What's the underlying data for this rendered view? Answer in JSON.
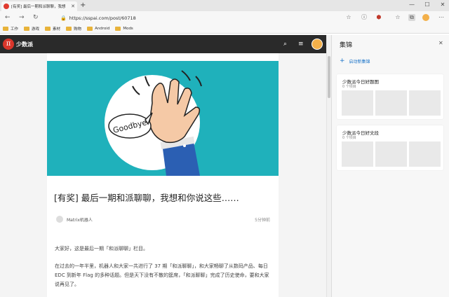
{
  "browser": {
    "tab_title": "[有奖] 最后一期和派聊聊，我想",
    "url": "https://sspai.com/post/60718",
    "colors": {
      "favicon": "#e03a2f",
      "folder": "#e8b33a"
    },
    "bookmarks": [
      "工作",
      "游戏",
      "素材",
      "购物",
      "Android",
      "Mods"
    ]
  },
  "site": {
    "logo_glyph": "π",
    "logo_text": "少数派"
  },
  "article": {
    "hero_text": "Goodbye",
    "title": "[有奖] 最后一期和派聊聊，我想和你说这些……",
    "author": "Matrix机器人",
    "read_time": "5分钟前",
    "paragraphs": [
      "大家好，这是最后一期「和派聊聊」栏目。",
      "在过去的一年半里，机器人和大家一共进行了 37 期「和派聊聊」，和大家畅聊了从数码产品、每日 EDC 到新年 Flag 的多种话题。但是天下没有不散的筵席，「和派聊聊」完成了历史使命，要和大家说再见了。"
    ],
    "colors": {
      "hero_bg": "#1fb1bb",
      "accent": "#d9362b"
    }
  },
  "collections": {
    "title": "集锦",
    "new_label": "启动新集锦",
    "cards": [
      {
        "title": "少数派今日好题图",
        "count": "0 个项目"
      },
      {
        "title": "少数派今日好文段",
        "count": "0 个项目"
      }
    ],
    "accent": "#1a73c8"
  }
}
